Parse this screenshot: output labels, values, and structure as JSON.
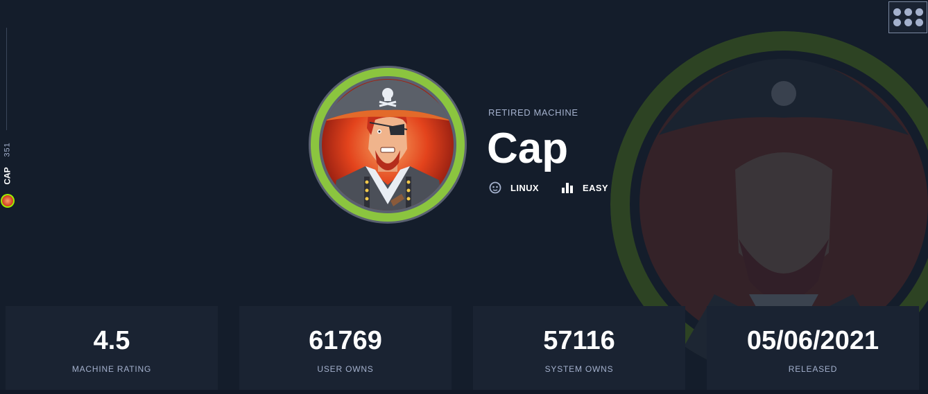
{
  "rail": {
    "machine_number": "351",
    "machine_label": "CAP"
  },
  "menu": {
    "icon": "apps-grid-icon"
  },
  "machine": {
    "status": "RETIRED MACHINE",
    "name": "Cap",
    "os": {
      "icon": "linux-icon",
      "label": "LINUX"
    },
    "difficulty": {
      "icon": "difficulty-bars-icon",
      "label": "EASY"
    }
  },
  "stats": [
    {
      "value": "4.5",
      "label": "MACHINE RATING"
    },
    {
      "value": "61769",
      "label": "USER OWNS"
    },
    {
      "value": "57116",
      "label": "SYSTEM OWNS"
    },
    {
      "value": "05/06/2021",
      "label": "RELEASED"
    }
  ],
  "colors": {
    "background": "#141d2b",
    "card": "#1a2332",
    "accent_easy": "#9fef00",
    "muted_text": "#a4b1cd"
  }
}
